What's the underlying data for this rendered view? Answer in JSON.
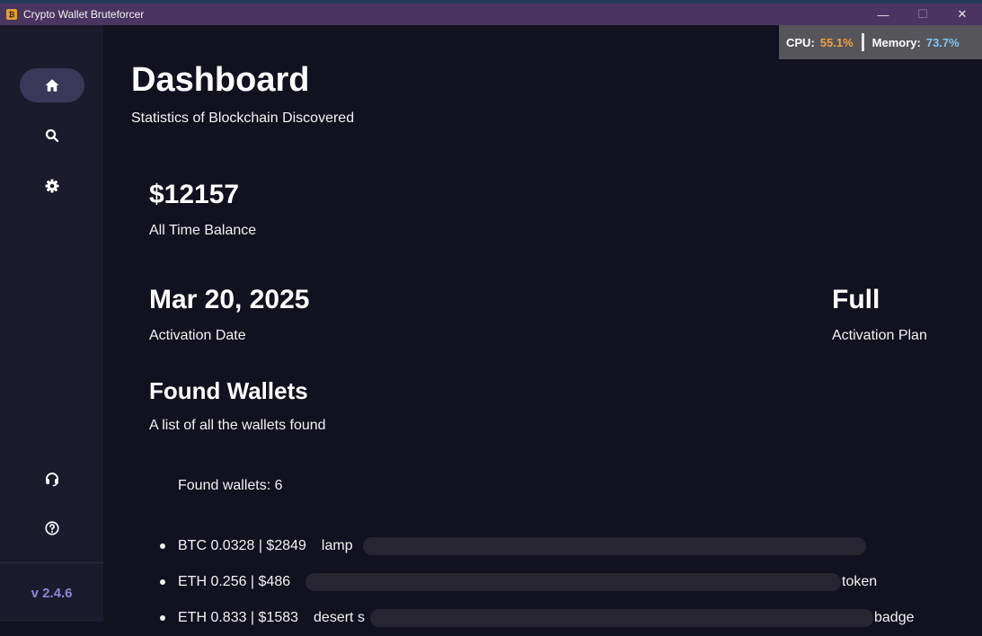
{
  "window": {
    "title": "Crypto Wallet Bruteforcer",
    "minimize": "—",
    "maximize": "☐",
    "close": "✕"
  },
  "perf": {
    "cpu_label": "CPU:",
    "cpu_value": "55.1%",
    "mem_label": "Memory:",
    "mem_value": "73.7%"
  },
  "sidebar": {
    "items": [
      {
        "icon": "home-icon",
        "active": true
      },
      {
        "icon": "search-icon",
        "active": false
      },
      {
        "icon": "gear-icon",
        "active": false
      },
      {
        "icon": "headset-icon",
        "active": false
      },
      {
        "icon": "help-icon",
        "active": false
      }
    ],
    "version": "v 2.4.6"
  },
  "header": {
    "title": "Dashboard",
    "subtitle": "Statistics of Blockchain Discovered"
  },
  "stats": {
    "balance_value": "$12157",
    "balance_label": "All Time Balance",
    "activation_date_value": "Mar 20, 2025",
    "activation_date_label": "Activation Date",
    "plan_value": "Full",
    "plan_label": "Activation Plan"
  },
  "found": {
    "title": "Found Wallets",
    "subtitle": "A list of all the wallets found",
    "count_text": "Found wallets: 6",
    "wallets": [
      {
        "info": "BTC 0.0328 | $2849",
        "head": "lamp",
        "tail": ""
      },
      {
        "info": "ETH 0.256 | $486",
        "head": "",
        "tail": "token"
      },
      {
        "info": "ETH 0.833 | $1583",
        "head": "desert s",
        "tail": "badge"
      }
    ]
  },
  "colors": {
    "background": "#12111f",
    "sidebar": "#1c1b2e",
    "titlebar": "#4a3560",
    "accent_version": "#8a88d0",
    "cpu": "#f0a040",
    "memory": "#7ec6f0"
  }
}
